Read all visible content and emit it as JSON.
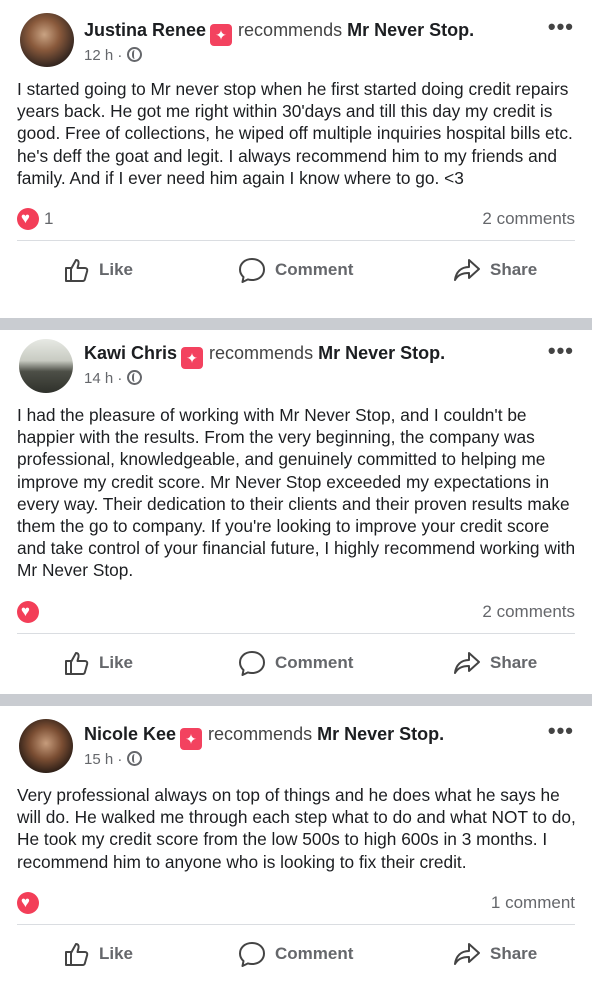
{
  "posts": [
    {
      "author": "Justina Renee",
      "recommends_text": "recommends",
      "page": "Mr Never Stop.",
      "time": "12 h",
      "text": "I started going to Mr never stop when he first started doing credit repairs years back. He got me right within 30'days and till this day my credit is good. Free of collections, he wiped off multiple inquiries hospital bills etc. he's deff the goat and legit. I always recommend him to my friends and family. And if I ever need him again I know where to go. <3",
      "reactions": "1",
      "comments": "2 comments"
    },
    {
      "author": "Kawi Chris",
      "recommends_text": "recommends",
      "page": "Mr Never Stop.",
      "time": "14 h",
      "text": "I had the pleasure of working with Mr Never Stop, and I couldn't be happier with the results. From the very beginning, the company was professional, knowledgeable, and genuinely committed to helping me improve my credit score. Mr Never Stop exceeded my expectations in every way. Their dedication to their clients and their proven results make them the go to company. If you're looking to improve your credit score and take control of your financial future, I highly recommend working with Mr Never Stop.",
      "reactions": "",
      "comments": "2 comments"
    },
    {
      "author": "Nicole Kee",
      "recommends_text": "recommends",
      "page": "Mr Never Stop.",
      "time": "15 h",
      "text": "Very professional always on top of things and he does what he says he will do. He walked me through each step what to do and what NOT to do, He took my credit score from the low 500s to high 600s in 3 months. I recommend him to anyone who is looking to fix their credit.",
      "reactions": "",
      "comments": "1 comment"
    }
  ],
  "actions": {
    "like": "Like",
    "comment": "Comment",
    "share": "Share"
  },
  "more_glyph": "•••",
  "meta_sep": "·",
  "colors": {
    "reaction": "#f33e58",
    "badge": "#f3425f",
    "muted": "#65676b",
    "divider": "#c9ccd1"
  },
  "icons": [
    "thumbs-up-icon",
    "comment-bubble-icon",
    "share-arrow-icon",
    "globe-icon",
    "heart-icon",
    "recommend-badge-icon",
    "more-options-icon"
  ]
}
